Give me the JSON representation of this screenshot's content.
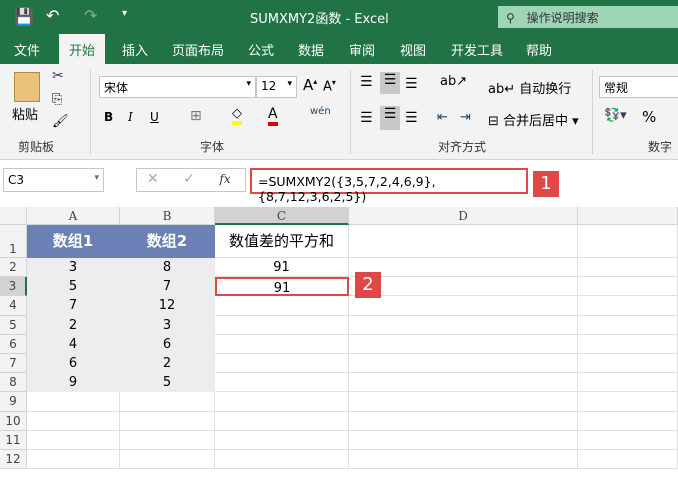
{
  "title": {
    "text": "SUMXMY2函数  -  Excel",
    "search": "操作说明搜索"
  },
  "tabs": [
    "文件",
    "开始",
    "插入",
    "页面布局",
    "公式",
    "数据",
    "审阅",
    "视图",
    "开发工具",
    "帮助"
  ],
  "ribbon": {
    "paste": "粘贴",
    "clipboard": "剪贴板",
    "font_name": "宋体",
    "font_size": "12",
    "font": "字体",
    "wrap": "自动换行",
    "merge": "合并后居中",
    "align": "对齐方式",
    "number_format": "常规",
    "number": "数字",
    "bold": "B",
    "italic": "I",
    "underline": "U",
    "percent": "%"
  },
  "formula": {
    "namebox": "C3",
    "fx": "fx",
    "text": "=SUMXMY2({3,5,7,2,4,6,9},{8,7,12,3,6,2,5})",
    "cancel": "✕",
    "enter": "✓"
  },
  "columns": [
    "A",
    "B",
    "C",
    "D"
  ],
  "rows": [
    "1",
    "2",
    "3",
    "4",
    "5",
    "6",
    "7",
    "8",
    "9",
    "10",
    "11",
    "12"
  ],
  "headers": [
    "数组1",
    "数组2",
    "数值差的平方和"
  ],
  "colA": [
    "3",
    "5",
    "7",
    "2",
    "4",
    "6",
    "9"
  ],
  "colB": [
    "8",
    "7",
    "12",
    "3",
    "6",
    "2",
    "5"
  ],
  "colC": [
    "91",
    "91"
  ],
  "badges": [
    "1",
    "2"
  ],
  "colors": {
    "brand": "#217346",
    "header_fill": "#6b80b4",
    "data_fill": "#ededed",
    "badge": "#e04848"
  }
}
